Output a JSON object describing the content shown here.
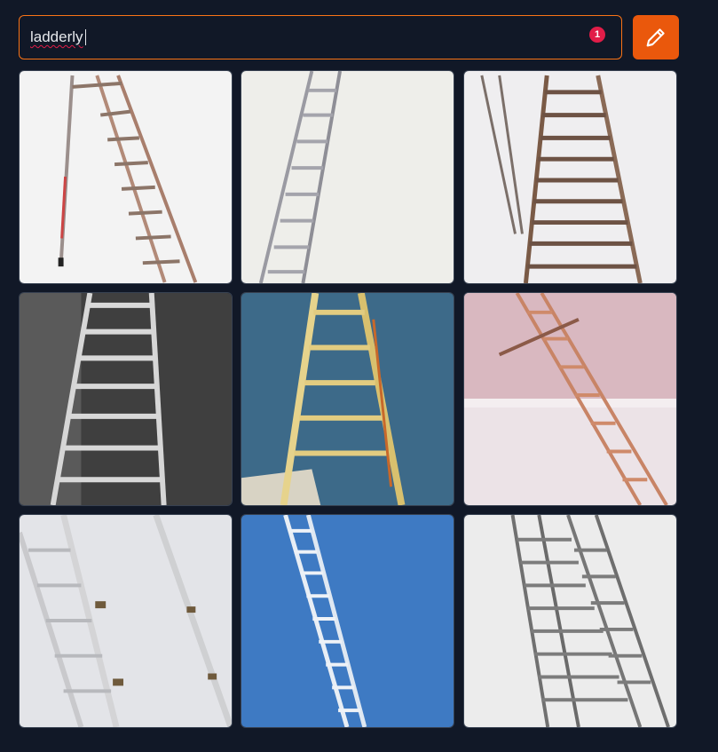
{
  "prompt": {
    "value": "ladderly",
    "badge_count": "1"
  },
  "generate_button": {
    "icon": "pencil-icon",
    "color": "#ea580c"
  },
  "accent_border": "#f97316",
  "images": [
    {
      "name": "ladder-image-1",
      "background": "#f1f1f1"
    },
    {
      "name": "ladder-image-2",
      "background": "#ececec"
    },
    {
      "name": "ladder-image-3",
      "background": "#efedee"
    },
    {
      "name": "ladder-image-4",
      "background": "#4b4b4b"
    },
    {
      "name": "ladder-image-5",
      "background": "#3f6b8a"
    },
    {
      "name": "ladder-image-6",
      "background": "#e7d7dc"
    },
    {
      "name": "ladder-image-7",
      "background": "#e6e7ea"
    },
    {
      "name": "ladder-image-8",
      "background": "#3f78c2"
    },
    {
      "name": "ladder-image-9",
      "background": "#ececec"
    }
  ]
}
